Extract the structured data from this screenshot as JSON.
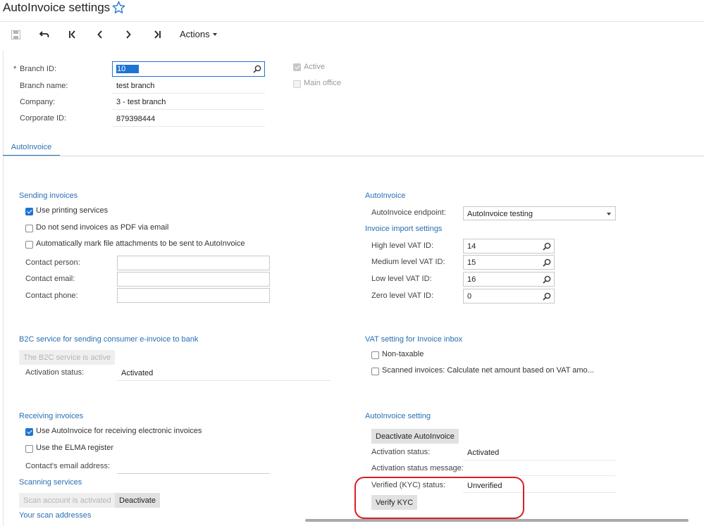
{
  "header": {
    "title": "AutoInvoice settings"
  },
  "toolbar": {
    "actions_label": "Actions"
  },
  "summary": {
    "branch_id_label": "Branch ID:",
    "branch_id_value": "10",
    "branch_name_label": "Branch name:",
    "branch_name_value": "test branch",
    "company_label": "Company:",
    "company_value": "3 - test branch",
    "corporate_id_label": "Corporate ID:",
    "corporate_id_value": "879398444",
    "active_label": "Active",
    "main_office_label": "Main office"
  },
  "tabs": [
    {
      "label": "AutoInvoice"
    }
  ],
  "sending": {
    "title": "Sending invoices",
    "use_printing_label": "Use printing services",
    "no_pdf_label": "Do not send invoices as PDF via email",
    "auto_mark_label": "Automatically mark file attachments to be sent to AutoInvoice",
    "contact_person_label": "Contact person:",
    "contact_email_label": "Contact email:",
    "contact_phone_label": "Contact phone:"
  },
  "autoinvoice": {
    "title": "AutoInvoice",
    "endpoint_label": "AutoInvoice endpoint:",
    "endpoint_value": "AutoInvoice testing"
  },
  "import_settings": {
    "title": "Invoice import settings",
    "high_label": "High level VAT ID:",
    "high_value": "14",
    "medium_label": "Medium level VAT ID:",
    "medium_value": "15",
    "low_label": "Low level VAT ID:",
    "low_value": "16",
    "zero_label": "Zero level VAT ID:",
    "zero_value": "0"
  },
  "b2c": {
    "title": "B2C service for sending consumer e-invoice to bank",
    "button_label": "The B2C service is active",
    "status_label": "Activation status:",
    "status_value": "Activated"
  },
  "vat_inbox": {
    "title": "VAT setting for Invoice inbox",
    "non_taxable_label": "Non-taxable",
    "scanned_label": "Scanned invoices: Calculate net amount based on VAT amo..."
  },
  "receiving": {
    "title": "Receiving invoices",
    "use_autoinvoice_label": "Use AutoInvoice for receiving electronic invoices",
    "use_elma_label": "Use the ELMA register",
    "contact_email_label": "Contact's email address:"
  },
  "scanning": {
    "title": "Scanning services",
    "scan_button_label": "Scan account is activated",
    "deactivate_label": "Deactivate",
    "scan_addresses_title": "Your scan addresses"
  },
  "ai_setting": {
    "title": "AutoInvoice setting",
    "deactivate_button_label": "Deactivate AutoInvoice",
    "activation_status_label": "Activation status:",
    "activation_status_value": "Activated",
    "activation_message_label": "Activation status message:",
    "kyc_status_label": "Verified (KYC) status:",
    "kyc_status_value": "Unverified",
    "verify_kyc_label": "Verify KYC"
  },
  "colors": {
    "accent": "#2a6fb5",
    "highlight": "#d81e24",
    "checkbox": "#1e74d2"
  }
}
